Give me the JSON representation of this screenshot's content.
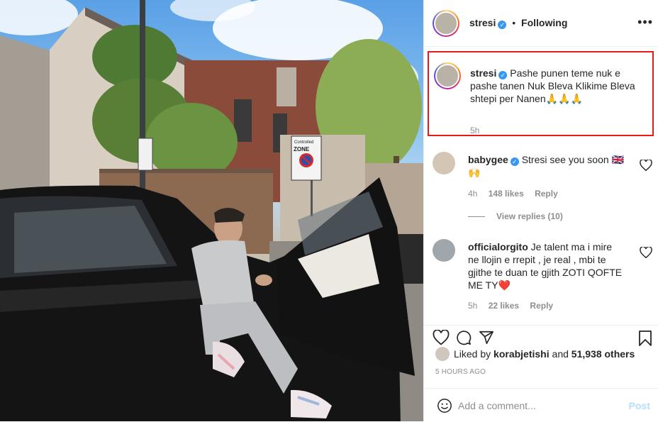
{
  "header": {
    "username": "stresi",
    "separator": "•",
    "follow_status": "Following",
    "more_icon": "more-horizontal-icon"
  },
  "caption": {
    "username": "stresi",
    "text": "Pashe punen teme nuk e pashe tanen Nuk Bleva Klikime Bleva shtepi per Nanen🙏🙏🙏",
    "time": "5h"
  },
  "comments": [
    {
      "username": "babygee",
      "text": "Stresi see you soon 🇬🇧🙌",
      "time": "4h",
      "likes": "148 likes",
      "reply": "Reply",
      "view_replies": "View replies (10)"
    },
    {
      "username": "officialorgito",
      "text": "Je talent ma i mire ne llojin e rrepit , je real , mbi te gjithe te duan te gjith ZOTI QOFTE ME TY❤️",
      "time": "5h",
      "likes": "22 likes",
      "reply": "Reply"
    }
  ],
  "actions": {
    "liked_prefix": "Liked by",
    "liked_user": "korabjetishi",
    "liked_and": "and",
    "liked_others": "51,938 others",
    "time_ago": "5 HOURS AGO"
  },
  "add_comment": {
    "placeholder": "Add a comment...",
    "post_label": "Post"
  },
  "photo": {
    "sign_line1": "Controlled",
    "sign_line2": "ZONE"
  },
  "colors": {
    "accent": "#3897f0",
    "highlight_border": "#e51b1b",
    "post_disabled": "#b2dffc"
  }
}
